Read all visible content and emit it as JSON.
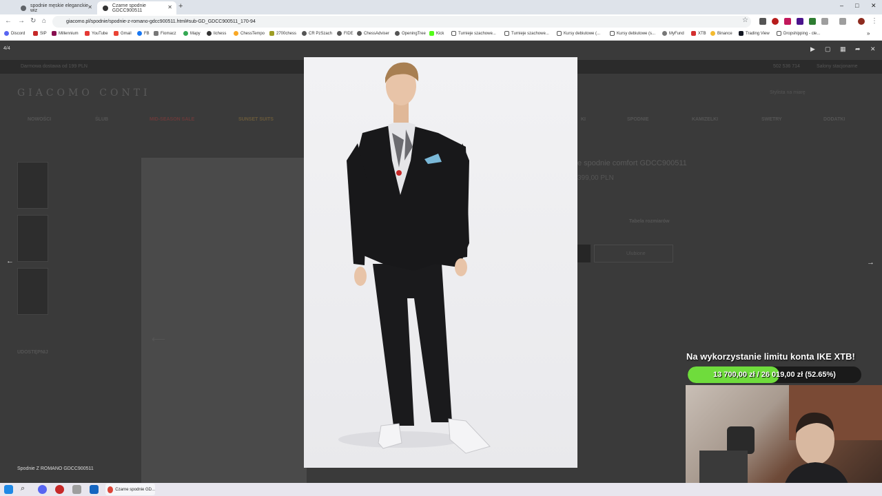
{
  "browser": {
    "tabs": [
      {
        "title": "spodnie męskie eleganckie wiz"
      },
      {
        "title": "Czarne spodnie GDCC900511"
      }
    ],
    "new_tab": "+",
    "window_controls": [
      "–",
      "□",
      "✕"
    ],
    "url": "giacomo.pl/spodnie/spodnie-z-romano-gdcc900511.html#sub-GD_GDCC900511_170-94",
    "bookmarks": [
      "Discord",
      "SIP",
      "Millennium",
      "YouTube",
      "Gmail",
      "FB",
      "Fiomacz",
      "Mapy",
      "lichess",
      "ChessTempo",
      "2700chess",
      "CR PzSzach",
      "FIDE",
      "ChessAdviser",
      "OpeningTree",
      "Kick",
      "Turnieje szachowe...",
      "Turnieje szachowe...",
      "Kursy debiutowe (...",
      "Kursy debiutowe (s...",
      "MyFund",
      "XTB",
      "Binance",
      "Trading View",
      "Dropshipping - cle..."
    ],
    "bookmarks_more": "»"
  },
  "page": {
    "promo_left": "Darmowa dostawa od 199 PLN",
    "promo_phone": "502 536 714",
    "promo_shops": "Salony stacjonarne",
    "logo": "GIACOMO CONTI",
    "nav": [
      "NOWOŚCI",
      "ŚLUB",
      "MID-SEASON SALE",
      "SUNSET SUITS",
      "KI",
      "SPODNIE",
      "KAMIZELKI",
      "SWETRY",
      "DODATKI"
    ],
    "style_label": "Stylista na miarę",
    "product_title": "e spodnie comfort GDCC900511",
    "price": "399,00 PLN",
    "size_table": "Tabela rozmiarów",
    "wishlist": "Ulubione",
    "share": "UDOSTĘPNIJ",
    "caption": "Spodnie Z ROMANO GDCC900511"
  },
  "lightbox": {
    "counter": "4/4",
    "icons": [
      "play-icon",
      "fullscreen-icon",
      "grid-icon",
      "share-icon",
      "close-icon"
    ],
    "prev": "←",
    "next": "→"
  },
  "overlay": {
    "title": "Na wykorzystanie limitu konta IKE XTB!",
    "progress_text": "13 700,00 zł / 26 019,00 zł (52.65%)",
    "progress_fraction": 0.5265,
    "fill_color": "#6fdc3c"
  },
  "taskbar": {
    "active_window": "Czarne spodnie GD..."
  }
}
